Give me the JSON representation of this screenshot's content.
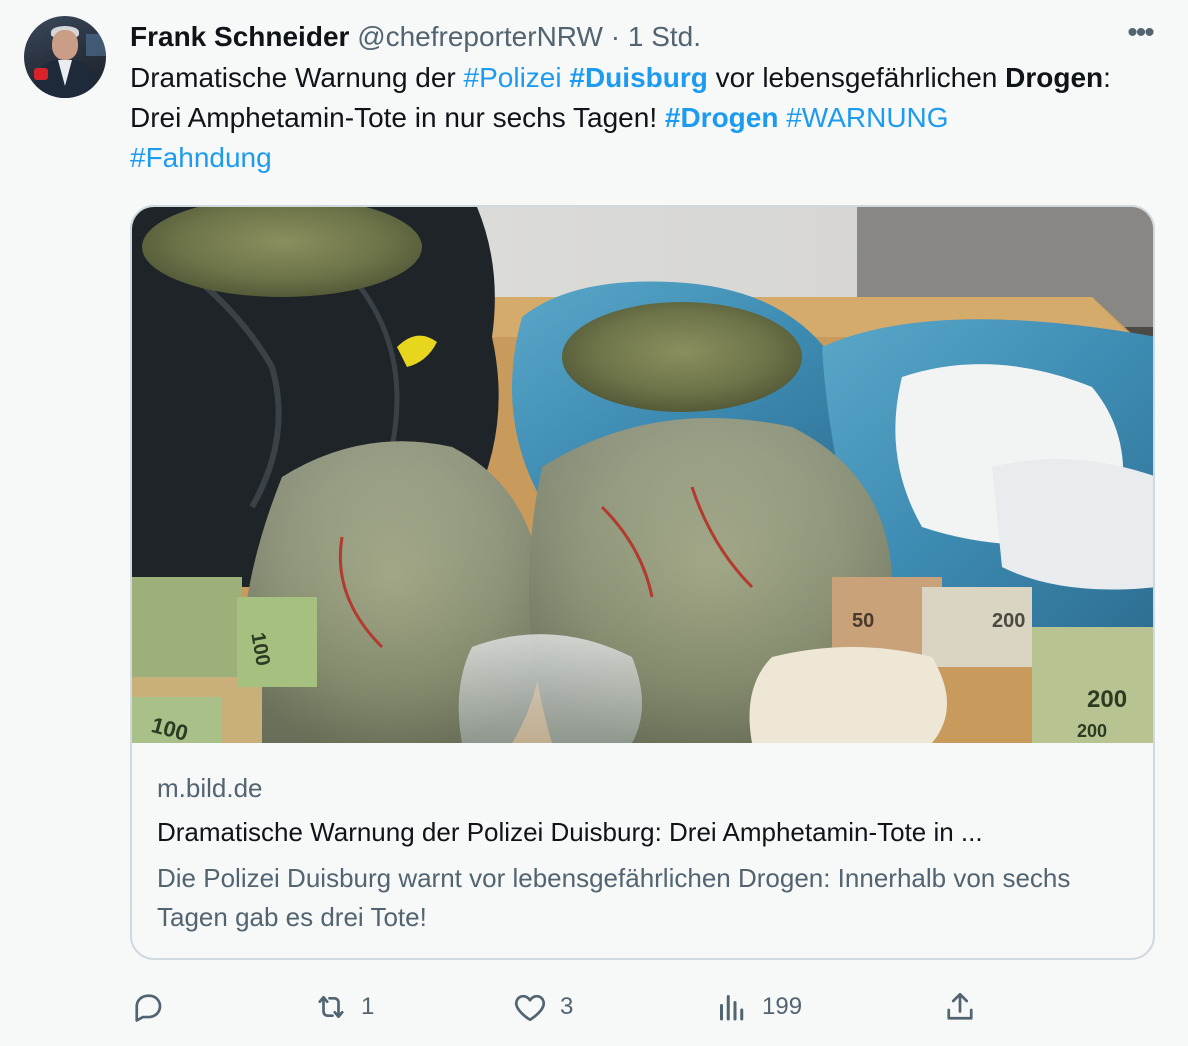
{
  "author": {
    "name": "Frank Schneider",
    "handle": "@chefreporterNRW",
    "separator": "·",
    "time": "1 Std."
  },
  "tweet": {
    "t1": "Dramatische Warnung der ",
    "tag1": "#Polizei",
    "t2": " ",
    "tag2": "#Duisburg",
    "t3": " vor lebensgefährlichen ",
    "bold1": "Drogen",
    "t4": ": Drei Amphetamin-Tote in nur sechs Tagen! ",
    "tag3": "#Drogen",
    "t5": " ",
    "tag4": "#WARNUNG",
    "t6": " ",
    "tag5": "#Fahndung"
  },
  "card": {
    "domain": "m.bild.de",
    "title": "Dramatische Warnung der Polizei Duisburg: Drei Amphetamin-Tote in ...",
    "description": "Die Polizei Duisburg warnt vor lebensgefährlichen Drogen: Innerhalb von sechs Tagen gab es drei Tote!",
    "image_text": {
      "n1": "100",
      "n2": "100",
      "n3": "50",
      "n4": "200",
      "n5": "200",
      "n6": "200"
    }
  },
  "actions": {
    "reply": {
      "icon": "reply-icon",
      "count": ""
    },
    "retweet": {
      "icon": "retweet-icon",
      "count": "1"
    },
    "like": {
      "icon": "heart-icon",
      "count": "3"
    },
    "views": {
      "icon": "views-icon",
      "count": "199"
    },
    "share": {
      "icon": "share-icon",
      "count": ""
    }
  },
  "colors": {
    "link": "#1d9bf0",
    "secondary": "#536471",
    "text": "#0f1419",
    "border": "#cfd9de",
    "background": "#f7f9f9"
  }
}
